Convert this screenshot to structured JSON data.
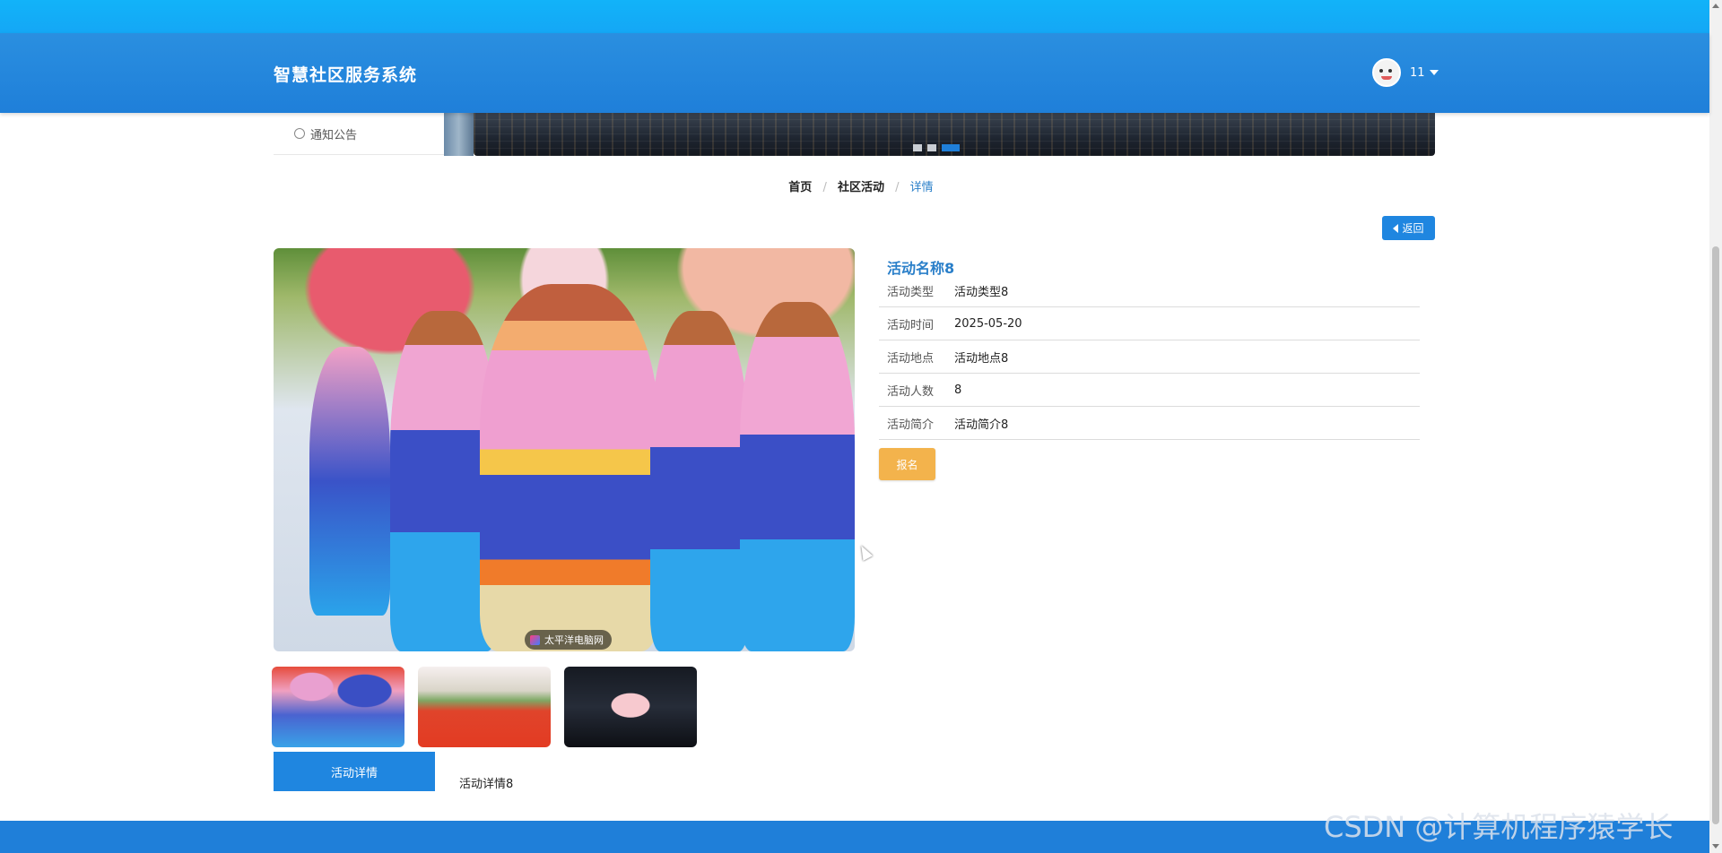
{
  "header": {
    "title": "智慧社区服务系统",
    "username": "11"
  },
  "side_menu": {
    "item_label": "通知公告"
  },
  "banner": {
    "active_dot": 3,
    "dot_count": 3
  },
  "breadcrumb": {
    "home": "首页",
    "section": "社区活动",
    "current": "详情",
    "separator": "/"
  },
  "back_button": {
    "label": "返回"
  },
  "main_image": {
    "watermark": "太平洋电脑网"
  },
  "detail": {
    "title": "活动名称8",
    "rows": [
      {
        "label": "活动类型",
        "value": "活动类型8"
      },
      {
        "label": "活动时间",
        "value": "2025-05-20"
      },
      {
        "label": "活动地点",
        "value": "活动地点8"
      },
      {
        "label": "活动人数",
        "value": "8"
      },
      {
        "label": "活动简介",
        "value": "活动简介8"
      }
    ],
    "signup_label": "报名"
  },
  "tabs": {
    "active_label": "活动详情",
    "content": "活动详情8"
  },
  "overlay": {
    "watermark": "CSDN @计算机程序猿学长"
  },
  "colors": {
    "header_blue": "#1f7fd9",
    "accent_blue": "#1f86e0",
    "title_blue": "#2a7fc9",
    "signup_orange": "#f3b34c"
  }
}
